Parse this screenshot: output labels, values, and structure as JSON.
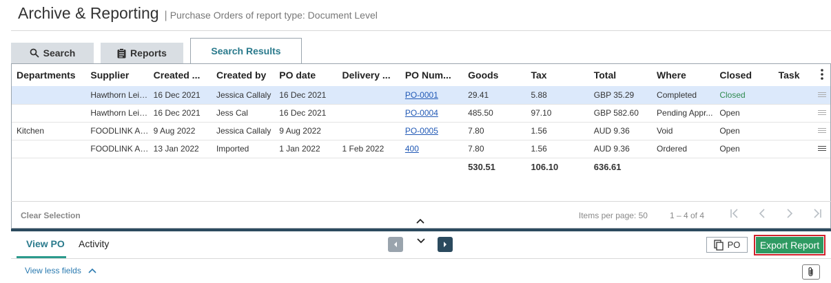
{
  "header": {
    "title": "Archive & Reporting",
    "separator": "|",
    "subtitle": "Purchase Orders of report type: Document Level"
  },
  "tabs": [
    {
      "label": "Search",
      "icon": "search-icon"
    },
    {
      "label": "Reports",
      "icon": "clipboard-icon"
    },
    {
      "label": "Search Results",
      "active": true
    }
  ],
  "table": {
    "columns": [
      "Departments",
      "Supplier",
      "Created ...",
      "Created by",
      "PO date",
      "Delivery ...",
      "PO Num...",
      "Goods",
      "Tax",
      "Total",
      "Where",
      "Closed",
      "Task"
    ],
    "rows": [
      {
        "department": "",
        "supplier": "Hawthorn Leis...",
        "created": "16 Dec 2021",
        "created_by": "Jessica Callaly",
        "po_date": "16 Dec 2021",
        "delivery": "",
        "po_num": "PO-0001",
        "goods": "29.41",
        "tax": "5.88",
        "total": "GBP 35.29",
        "where": "Completed",
        "closed": "Closed",
        "selected": true
      },
      {
        "department": "",
        "supplier": "Hawthorn Leis...",
        "created": "16 Dec 2021",
        "created_by": "Jess Cal",
        "po_date": "16 Dec 2021",
        "delivery": "",
        "po_num": "PO-0004",
        "goods": "485.50",
        "tax": "97.10",
        "total": "GBP 582.60",
        "where": "Pending Appr...",
        "closed": "Open"
      },
      {
        "department": "Kitchen",
        "supplier": "FOODLINK AU...",
        "created": "9 Aug 2022",
        "created_by": "Jessica Callaly",
        "po_date": "9 Aug 2022",
        "delivery": "",
        "po_num": "PO-0005",
        "goods": "7.80",
        "tax": "1.56",
        "total": "AUD 9.36",
        "where": "Void",
        "closed": "Open"
      },
      {
        "department": "",
        "supplier": "FOODLINK AU...",
        "created": "13 Jan 2022",
        "created_by": "Imported",
        "po_date": "1 Jan 2022",
        "delivery": "1 Feb 2022",
        "po_num": "400",
        "goods": "7.80",
        "tax": "1.56",
        "total": "AUD 9.36",
        "where": "Ordered",
        "closed": "Open"
      }
    ],
    "totals": {
      "goods": "530.51",
      "tax": "106.10",
      "total": "636.61"
    }
  },
  "footer": {
    "clear_selection": "Clear Selection",
    "items_per_page": "Items per page: 50",
    "range": "1 – 4 of 4"
  },
  "bottom": {
    "tab_view_po": "View PO",
    "tab_activity": "Activity",
    "po_button": "PO",
    "export_button": "Export Report",
    "view_less": "View less fields"
  },
  "colors": {
    "accent": "#2a7a8c",
    "export_green": "#2e9a62",
    "highlight_red": "#d0202a",
    "selected_row": "#dce9fb",
    "divider": "#2b4a5e"
  }
}
